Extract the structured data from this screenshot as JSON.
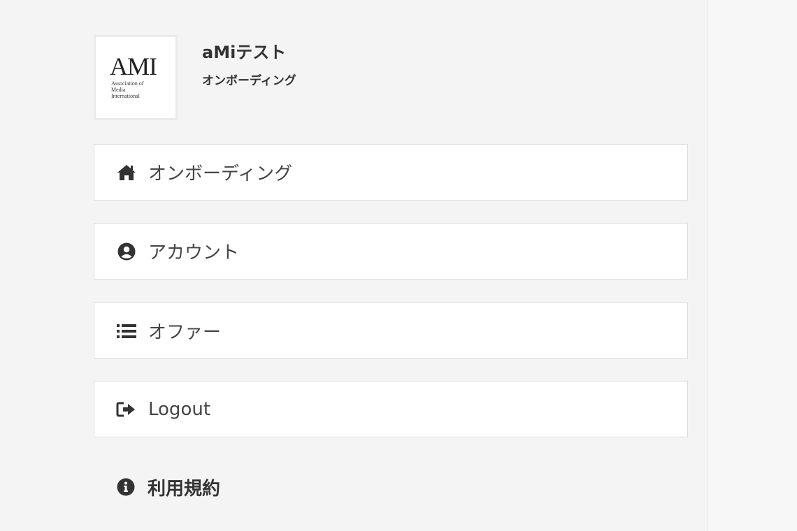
{
  "profile": {
    "logo_main": "AMI",
    "logo_sub": "Association of\nMedia\nInternational",
    "title": "aMiテスト",
    "subtitle": "オンボーディング"
  },
  "menu": {
    "items": [
      {
        "label": "オンボーディング",
        "icon": "home-icon"
      },
      {
        "label": "アカウント",
        "icon": "user-circle-icon"
      },
      {
        "label": "オファー",
        "icon": "list-icon"
      },
      {
        "label": "Logout",
        "icon": "logout-icon"
      }
    ]
  },
  "footer": {
    "terms_label": "利用規約",
    "terms_icon": "info-circle-icon"
  }
}
